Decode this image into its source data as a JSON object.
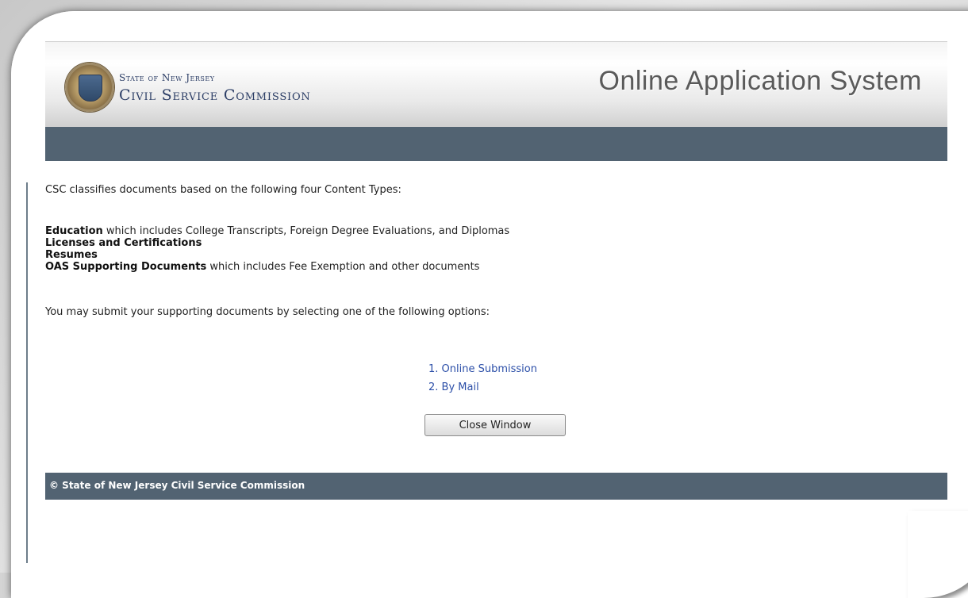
{
  "header": {
    "org_line1": "State of New Jersey",
    "org_line2": "Civil Service Commission",
    "system_title": "Online Application System"
  },
  "content": {
    "intro": "CSC classifies documents based on the following four Content Types:",
    "types": [
      {
        "label": "Education",
        "detail": " which includes College Transcripts, Foreign Degree Evaluations, and Diplomas"
      },
      {
        "label": "Licenses and Certifications",
        "detail": ""
      },
      {
        "label": "Resumes",
        "detail": ""
      },
      {
        "label": "OAS Supporting Documents",
        "detail": " which includes Fee Exemption and other documents"
      }
    ],
    "options_text": "You may submit your supporting documents by selecting one of the following options:",
    "options": [
      "1. Online Submission",
      "2. By Mail"
    ],
    "close_button": "Close Window"
  },
  "footer": {
    "text": "© State of New Jersey Civil Service Commission"
  },
  "colors": {
    "nav_bar": "#526372",
    "link": "#2c4fa8"
  },
  "icons": {
    "seal": "state-seal-icon"
  }
}
